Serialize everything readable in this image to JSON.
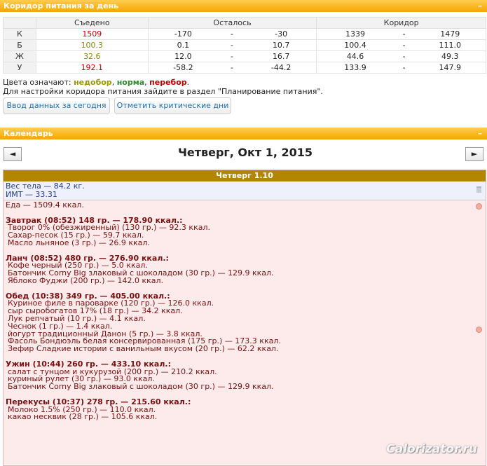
{
  "corridor_panel": {
    "title": "Коридор питания за день",
    "collapse": "–",
    "headers": {
      "eaten": "Съедено",
      "left": "Осталось",
      "corridor": "Коридор"
    },
    "rows": [
      {
        "label": "К",
        "eaten": "1509",
        "left_min": "-170",
        "left_max": "-30",
        "c_min": "1339",
        "sep": "-",
        "c_max": "1479"
      },
      {
        "label": "Б",
        "eaten": "100.3",
        "left_min": "0.1",
        "left_max": "10.7",
        "c_min": "100.4",
        "sep": "-",
        "c_max": "111.0"
      },
      {
        "label": "Ж",
        "eaten": "32.6",
        "left_min": "12.0",
        "left_max": "16.7",
        "c_min": "44.6",
        "sep": "-",
        "c_max": "49.3"
      },
      {
        "label": "У",
        "eaten": "192.1",
        "left_min": "-58.2",
        "left_max": "-44.2",
        "c_min": "133.9",
        "sep": "-",
        "c_max": "147.9"
      }
    ],
    "dash": "-",
    "legend_prefix": "Цвета означают: ",
    "legend_under": "недобор",
    "legend_norm": "норма",
    "legend_over": "перебор",
    "comma": ", ",
    "dot": ".",
    "hint": "Для настройки коридора питания зайдите в раздел \"Планирование питания\".",
    "btn_today": "Ввод данных за сегодня",
    "btn_critical": "Отметить критические дни"
  },
  "calendar_panel": {
    "title": "Календарь",
    "collapse": "–",
    "prev": "◄",
    "next": "►",
    "date": "Четверг, Окт 1, 2015",
    "day_header": "Четверг 1.10",
    "weight": "Вес тела — 84.2 кг.",
    "bmi": "ИМТ — 33.31",
    "food_total": "Еда — 1509.4 ккал.",
    "meals": [
      {
        "title": "Завтрак (08:52) 148 гр. — 178.90 ккал.:",
        "items": [
          "Творог 0% (обезжиренный) (130 гр.) — 92.3 ккал.",
          "Сахар-песок (15 гр.) — 59.7 ккал.",
          "Масло льняное (3 гр.) — 26.9 ккал."
        ]
      },
      {
        "title": "Ланч (08:52) 480 гр. — 276.90 ккал.:",
        "items": [
          "Кофе черный (250 гр.) — 5.0 ккал.",
          "Батончик Corny Big злаковый с шоколадом (30 гр.) — 129.9 ккал.",
          "Яблоко Фуджи (200 гр.) — 142.0 ккал."
        ]
      },
      {
        "title": "Обед (10:38) 349 гр. — 405.00 ккал.:",
        "items": [
          "Куриное филе в пароварке (120 гр.) — 126.0 ккал.",
          "сыр сыробогатов 17% (18 гр.) — 34.2 ккал.",
          "Лук репчатый (10 гр.) — 4.1 ккал.",
          "Чеснок (1 гр.) — 1.4 ккал.",
          "йогурт традиционный Данон (5 гр.) — 3.8 ккал.",
          "Фасоль Бондюэль белая консервированная (175 гр.) — 173.3 ккал.",
          "Зефир Сладкие истории с ванильным вкусом (20 гр.) — 62.2 ккал."
        ]
      },
      {
        "title": "Ужин (10:44) 260 гр. — 433.10 ккал.:",
        "items": [
          "салат с тунцом и кукурузой (200 гр.) — 210.2 ккал.",
          "куриный рулет (30 гр.) — 93.0 ккал.",
          "Батончик Corny Big злаковый с шоколадом (30 гр.) — 129.9 ккал."
        ]
      },
      {
        "title": "Перекусы (10:37) 278 гр. — 215.60 ккал.:",
        "items": [
          "Молоко 1.5% (250 гр.) — 110.0 ккал.",
          "какао несквик (28 гр.) — 105.6 ккал."
        ]
      }
    ]
  },
  "watermark": "Calorizator.ru",
  "colors": {
    "header": "#f6a500",
    "day_header": "#b38600",
    "food_bg": "#fdeaea",
    "weight_bg": "#eef0fb",
    "over": "#c00000",
    "under": "#9a9a00",
    "norm": "#2f8a2f"
  }
}
